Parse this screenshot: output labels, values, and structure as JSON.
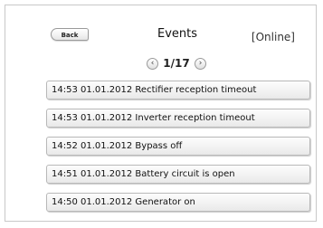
{
  "header": {
    "back_label": "Back",
    "title": "Events",
    "status": "[Online]"
  },
  "pager": {
    "page": "1/17",
    "prev_icon": "chevron-left-icon",
    "next_icon": "chevron-right-icon"
  },
  "events": [
    {
      "text": "14:53  01.01.2012  Rectifier reception timeout"
    },
    {
      "text": "14:53  01.01.2012  Inverter reception timeout"
    },
    {
      "text": "14:52  01.01.2012  Bypass off"
    },
    {
      "text": "14:51  01.01.2012  Battery circuit is open"
    },
    {
      "text": "14:50  01.01.2012  Generator on"
    }
  ]
}
